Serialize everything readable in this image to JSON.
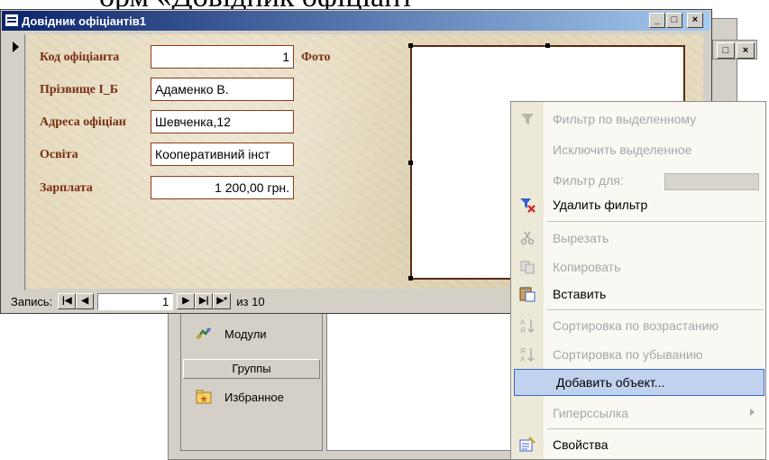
{
  "caption_partial": "орм «Довідник офіціант",
  "form": {
    "title": "Довідник офіціантів1",
    "labels": {
      "code": "Код офіціанта",
      "surname": "Прізвище І_Б",
      "address": "Адреса офіціан",
      "education": "Освіта",
      "salary": "Зарплата",
      "photo": "Фото"
    },
    "values": {
      "code": "1",
      "surname": "Адаменко В.",
      "address": "Шевченка,12",
      "education": "Кооперативний інст",
      "salary": "1 200,00 грн."
    },
    "window_buttons": [
      "_",
      "□",
      "×"
    ]
  },
  "navigation": {
    "label": "Запись:",
    "current": "1",
    "of_label": "из 10"
  },
  "db_window": {
    "items": [
      {
        "label": "Модули",
        "icon": "module-icon"
      },
      {
        "label": "Избранное",
        "icon": "favorites-folder-icon"
      }
    ],
    "groups_label": "Группы"
  },
  "context_menu": {
    "items": [
      {
        "label": "Фильтр по выделенному",
        "enabled": false,
        "icon": "filter-selection-icon"
      },
      {
        "label": "Исключить выделенное",
        "enabled": false
      },
      {
        "label": "Фильтр для:",
        "enabled": false
      },
      {
        "label": "Удалить фильтр",
        "enabled": true,
        "icon": "remove-filter-icon"
      },
      {
        "label": "Вырезать",
        "enabled": false,
        "icon": "cut-icon"
      },
      {
        "label": "Копировать",
        "enabled": false,
        "icon": "copy-icon"
      },
      {
        "label": "Вставить",
        "enabled": true,
        "icon": "paste-icon"
      },
      {
        "label": "Сортировка по возрастанию",
        "enabled": false,
        "icon": "sort-ascending-icon"
      },
      {
        "label": "Сортировка по убыванию",
        "enabled": false,
        "icon": "sort-descending-icon"
      },
      {
        "label": "Добавить объект...",
        "enabled": true,
        "highlighted": true
      },
      {
        "label": "Гиперссылка",
        "enabled": false,
        "submenu": true
      },
      {
        "label": "Свойства",
        "enabled": true,
        "icon": "properties-icon"
      }
    ]
  },
  "colors": {
    "title_gradient_start": "#0a246a",
    "title_gradient_end": "#a6caf0",
    "label_color": "#7a2e12",
    "menu_highlight": "#c1d2ee",
    "menu_highlight_border": "#316ac5"
  }
}
